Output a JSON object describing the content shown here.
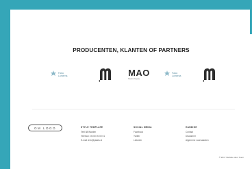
{
  "section": {
    "title": "PRODUCENTEN, KLANTEN OF PARTNERS"
  },
  "logos": [
    {
      "name": "Falco Lumerna",
      "line1": "Falco",
      "line2": "Lumerna"
    },
    {
      "name": "Orange M logo"
    },
    {
      "name": "MAO",
      "text": "MAO",
      "subtitle": "Maatschappij"
    },
    {
      "name": "Falco Lumerna",
      "line1": "Falco",
      "line2": "Lumerna"
    },
    {
      "name": "Orange M logo"
    }
  ],
  "footer": {
    "pill_label": "OM LOGO",
    "columns": [
      {
        "heading": "STYLE TEMPLATE",
        "lines": [
          "Teel 88 Warden",
          "Telefoon: 06 00 00 00 01",
          "E-mail: info@plaats.nl"
        ]
      },
      {
        "heading": "SOCIAL MEDIA",
        "lines": [
          "Facebook",
          "Twitter",
          "LinkedIn"
        ]
      },
      {
        "heading": "HANDIGE",
        "lines": [
          "Contact",
          "Disclaimer",
          "Algemene voorwaarden"
        ]
      }
    ],
    "copyright": "© 2017 Website door Teem"
  }
}
